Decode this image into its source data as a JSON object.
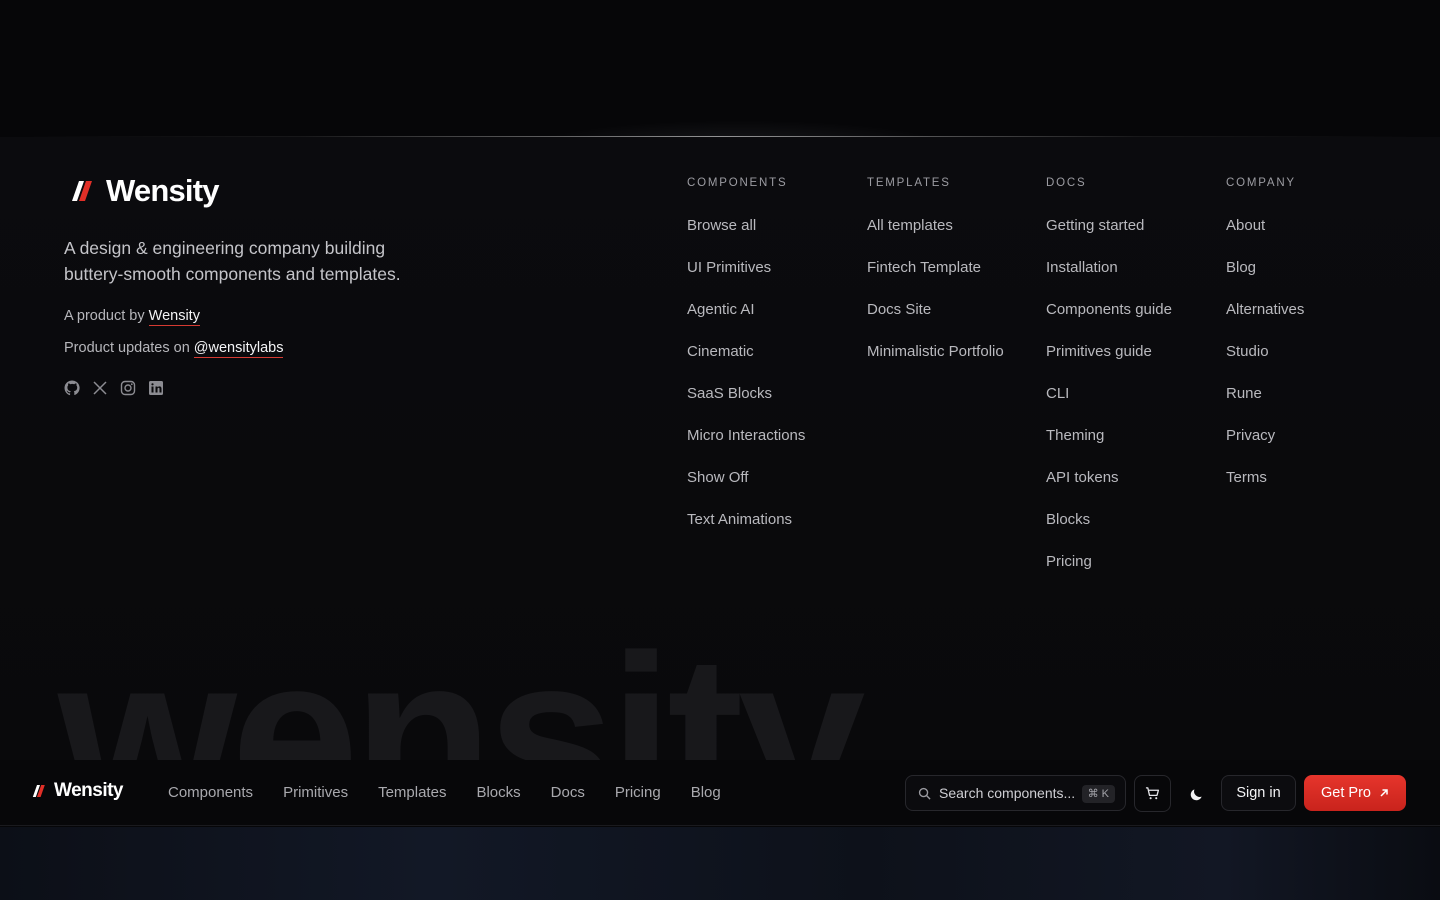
{
  "footer": {
    "brand_name": "Wensity",
    "tagline": "A design & engineering company building buttery-smooth components and templates.",
    "product_by_prefix": "A product by ",
    "product_by_link": "Wensity",
    "updates_prefix": "Product updates on ",
    "updates_link": "@wensitylabs",
    "socials": [
      "github-icon",
      "x-icon",
      "instagram-icon",
      "linkedin-icon"
    ],
    "columns": [
      {
        "heading": "COMPONENTS",
        "items": [
          "Browse all",
          "UI Primitives",
          "Agentic AI",
          "Cinematic",
          "SaaS Blocks",
          "Micro Interactions",
          "Show Off",
          "Text Animations"
        ]
      },
      {
        "heading": "TEMPLATES",
        "items": [
          "All templates",
          "Fintech Template",
          "Docs Site",
          "Minimalistic Portfolio"
        ]
      },
      {
        "heading": "DOCS",
        "items": [
          "Getting started",
          "Installation",
          "Components guide",
          "Primitives guide",
          "CLI",
          "Theming",
          "API tokens",
          "Blocks",
          "Pricing"
        ]
      },
      {
        "heading": "COMPANY",
        "items": [
          "About",
          "Blog",
          "Alternatives",
          "Studio",
          "Rune",
          "Privacy",
          "Terms"
        ]
      }
    ],
    "watermark": "wensity"
  },
  "nav": {
    "brand_name": "Wensity",
    "links": [
      "Components",
      "Primitives",
      "Templates",
      "Blocks",
      "Docs",
      "Pricing",
      "Blog"
    ],
    "search_placeholder": "Search components...",
    "search_shortcut": "⌘ K",
    "signin_label": "Sign in",
    "getpro_label": "Get Pro"
  },
  "colors": {
    "accent": "#e12f27",
    "background": "#060608"
  }
}
